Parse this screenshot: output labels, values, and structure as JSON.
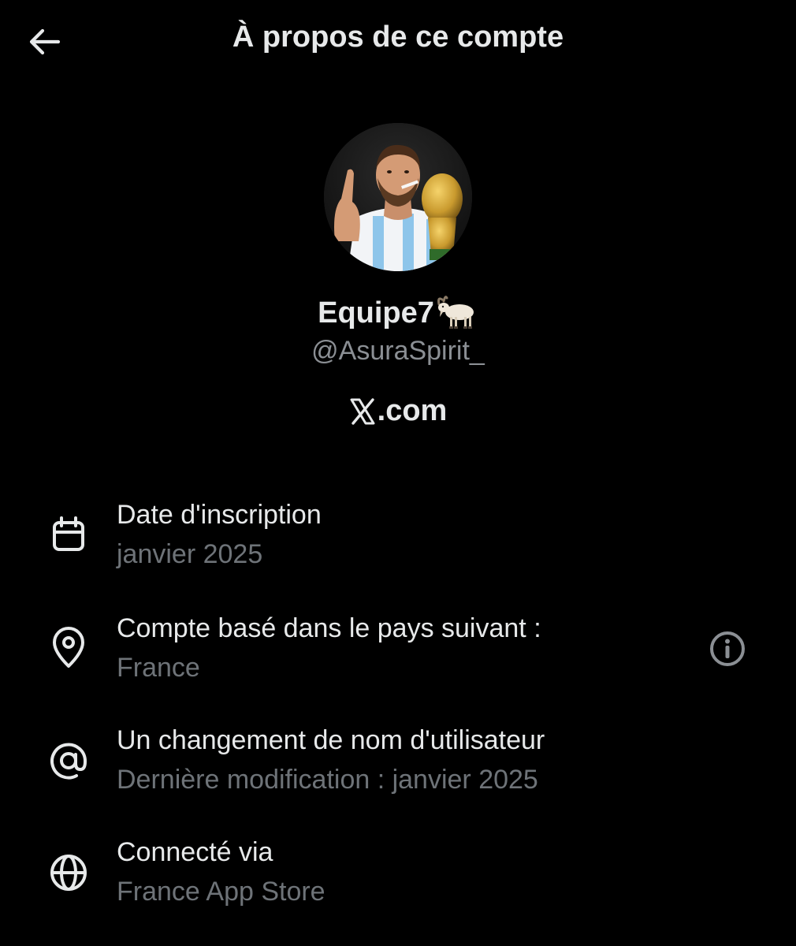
{
  "header": {
    "title": "À propos de ce compte",
    "back_icon": "arrow-left-icon"
  },
  "profile": {
    "display_name": "Equipe7",
    "name_emoji": "goat",
    "handle": "@AsuraSpirit_",
    "platform": ".com",
    "platform_logo": "x-logo-icon"
  },
  "rows": [
    {
      "icon": "calendar-icon",
      "title": "Date d'inscription",
      "value": "janvier 2025"
    },
    {
      "icon": "location-pin-icon",
      "title": "Compte basé dans le pays suivant :",
      "value": "France",
      "action_icon": "info-icon"
    },
    {
      "icon": "at-sign-icon",
      "title": "Un changement de nom d'utilisateur",
      "value": "Dernière modification : janvier 2025"
    },
    {
      "icon": "globe-icon",
      "title": "Connecté via",
      "value": "France App Store"
    }
  ],
  "colors": {
    "background": "#000000",
    "primary_text": "#e7e9ea",
    "secondary_text": "#6e7378",
    "handle_text": "#8b8f94",
    "icon": "#e7e9ea",
    "info_icon": "#8b8f94"
  }
}
